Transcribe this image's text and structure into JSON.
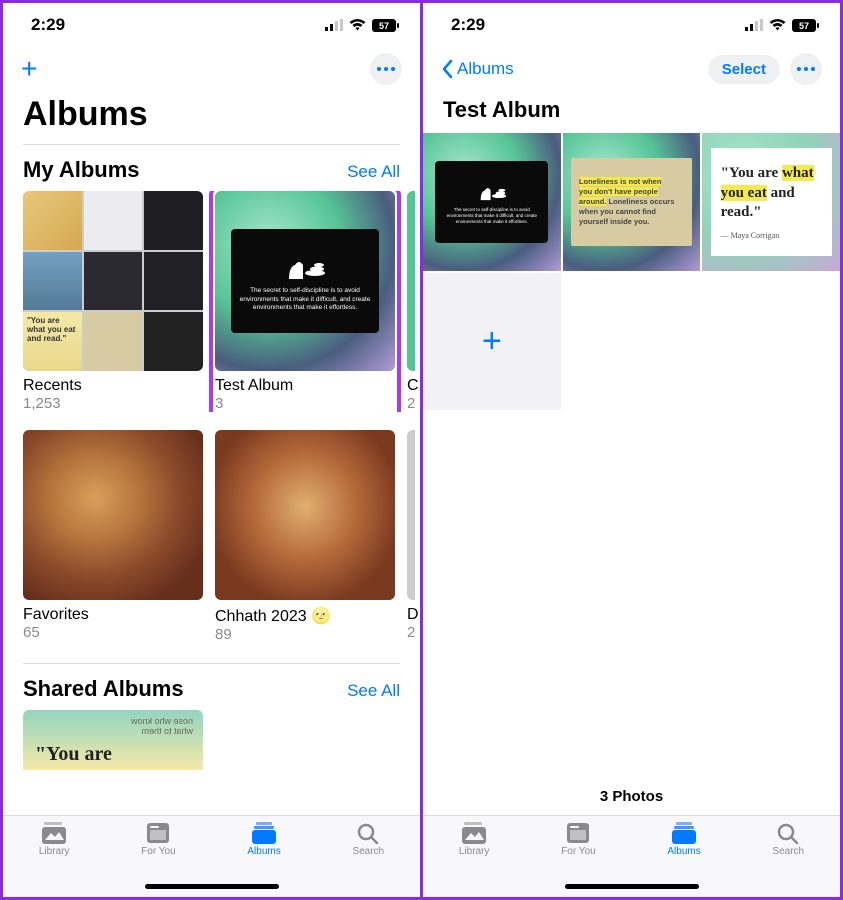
{
  "status": {
    "time": "2:29",
    "battery": "57"
  },
  "left": {
    "large_title": "Albums",
    "my_albums_title": "My Albums",
    "see_all": "See All",
    "albums": [
      {
        "name": "Recents",
        "count": "1,253"
      },
      {
        "name": "Test Album",
        "count": "3"
      },
      {
        "name_partial": "C",
        "count_partial": "2"
      }
    ],
    "second_row": [
      {
        "name": "Favorites",
        "count": "65"
      },
      {
        "name": "Chhath 2023 🌝",
        "count": "89"
      },
      {
        "name_partial": "D",
        "count_partial": "2"
      }
    ],
    "shared_title": "Shared Albums",
    "shared_peek_text": "\"You are"
  },
  "right": {
    "back_label": "Albums",
    "select_label": "Select",
    "album_title": "Test Album",
    "photos": {
      "p1_caption": "The secret to self-discipline is to avoid environments that make it difficult, and create environments that make it effortless.",
      "p2_text": "Loneliness is not when you don't have people around. Loneliness occurs when you cannot find yourself inside you.",
      "p3_quote": "\"You are what you eat and read.\"",
      "p3_attr": "— Maya Corrigan"
    },
    "footer_count": "3 Photos"
  },
  "tabs": {
    "library": "Library",
    "for_you": "For You",
    "albums": "Albums",
    "search": "Search"
  }
}
